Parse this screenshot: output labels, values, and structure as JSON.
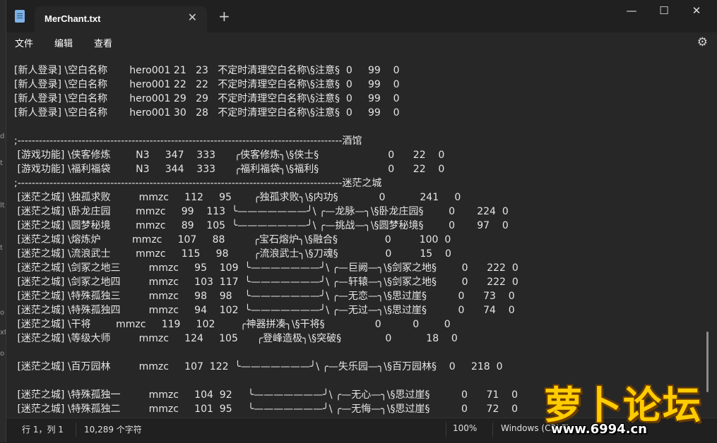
{
  "window": {
    "tab_title": "MerChant.txt",
    "tab_close": "✕",
    "new_tab": "+",
    "minimize": "—",
    "maximize": "☐",
    "close": "✕"
  },
  "menu": {
    "file": "文件",
    "edit": "编辑",
    "view": "查看",
    "settings_icon": "⚙"
  },
  "background_letters": [
    "d",
    "t",
    "lt",
    "t",
    "o",
    "xt",
    "o"
  ],
  "lines": [
    "[新人登录] \\空白名称       hero001 21   23   不定时清理空白名称\\§注意§  0     99    0",
    "[新人登录] \\空白名称       hero001 22   22   不定时清理空白名称\\§注意§  0     99    0",
    "[新人登录] \\空白名称       hero001 29   29   不定时清理空白名称\\§注意§  0     99    0",
    "[新人登录] \\空白名称       hero001 30   28   不定时清理空白名称\\§注意§  0     99    0",
    "",
    ";-------------------------------------------------------------------------------------------酒馆",
    " [游戏功能] \\侠客修炼        N3     347    333      ╭侠客修炼╮\\§侠士§                      0      22    0",
    " [游戏功能] \\福利福袋        N3     344    333      ╭福利福袋╮\\§福利§                      0      22    0",
    ";-------------------------------------------------------------------------------------------迷茫之城",
    " [迷茫之城] \\独孤求败         mmzc     112     95       ╭独孤求败╮\\§内功§             0           241     0",
    " [迷茫之城] \\卧龙庄园        mmzc     99    113  ╰———————╯\\ ╭—龙脉—╮\\§卧龙庄园§        0       224  0",
    " [迷茫之城] \\圆梦秘境        mmzc     89    105  ╰———————╯\\ ╭—挑战—╮\\§圆梦秘境§        0       97    0",
    " [迷茫之城] \\熔炼炉          mmzc     107     88         ╭宝石熔炉╮\\§融合§               0         100  0",
    " [迷茫之城] \\流浪武士        mmzc     115     98        ╭流浪武士╮\\§刀魂§               0         15    0",
    " [迷茫之城] \\剑冢之地三         mmzc     95    109  ╰———————╯\\ ╭—巨阙—╮\\§剑冢之地§        0      222  0",
    " [迷茫之城] \\剑冢之地四         mmzc     103  117  ╰———————╯\\ ╭—轩辕—╮\\§剑冢之地§        0      222  0",
    " [迷茫之城] \\特殊孤独三         mmzc     98    98    ╰———————╯\\ ╭—无恋—╮\\§思过崖§          0      73    0",
    " [迷茫之城] \\特殊孤独四         mmzc     94    102  ╰———————╯\\ ╭—无过—╮\\§思过崖§          0      74    0",
    " [迷茫之城] \\干将        mmzc     119     102        ╭神器拼凑╮\\§干将§                0          0        0",
    " [迷茫之城] \\等级大师         mmzc     124     105      ╭登峰造极╮\\§突破§              0           18    0",
    "",
    " [迷茫之城] \\百万园林         mmzc     107  122  ╰———————╯\\ ╭—失乐园—╮\\§百万园林§    0     218  0",
    "",
    " [迷茫之城] \\特殊孤独一         mmzc     104  92     ╰———————╯\\ ╭—无心—╮\\§思过崖§          0      71    0",
    " [迷茫之城] \\特殊孤独二         mmzc     101  95     ╰———————╯\\ ╭—无悔—╮\\§思过崖§          0      72    0"
  ],
  "status": {
    "position": "行 1，列 1",
    "chars": "10,289 个字符",
    "zoom": "100%",
    "eol": "Windows (CRLF)"
  },
  "watermark": {
    "text": "萝卜论坛",
    "url": "www.6994.cn"
  }
}
